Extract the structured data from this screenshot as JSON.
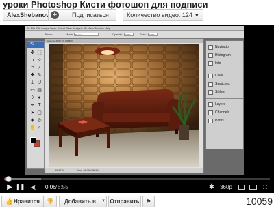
{
  "video": {
    "title": "уроки Photoshop Кисти фотошоп для подписи"
  },
  "channel": {
    "name": "AlexShebanov",
    "subscribe_label": "Подписаться",
    "video_count_label": "Количество видео: 124"
  },
  "photoshop": {
    "menu": "Ps   File   Edit   Image   Layer   Select   Filter   Analysis   3D   View   Window   Help",
    "tools_label": "Ps",
    "options": {
      "brush_label": "Brush:",
      "mode_label": "Mode:",
      "mode_value": "Normal",
      "opacity_label": "Opacity:",
      "opacity_value": "100%",
      "flow_label": "Flow:",
      "flow_value": "100%"
    },
    "document": {
      "title": "room.jpg @ 66.7% (RGB/8)",
      "zoom": "66.67%",
      "doc_size": "Doc: 46.9M/46.9M"
    },
    "panels": [
      "Navigator",
      "Histogram",
      "Info",
      "Color",
      "Swatches",
      "Styles",
      "Layers",
      "Channels",
      "Paths"
    ]
  },
  "player": {
    "progress_fraction": 0.015,
    "loaded_fraction": 0.14,
    "time_current": "0:06",
    "time_separator": "/",
    "time_total": "6:55",
    "quality": "360p"
  },
  "actions": {
    "like_label": "Нравится",
    "add_label": "Добавить в",
    "share_label": "Отправить"
  },
  "stats": {
    "views": "10059"
  },
  "colors": {
    "progress_red": "#cc181e",
    "photoshop_blue": "#3a6fb5"
  }
}
